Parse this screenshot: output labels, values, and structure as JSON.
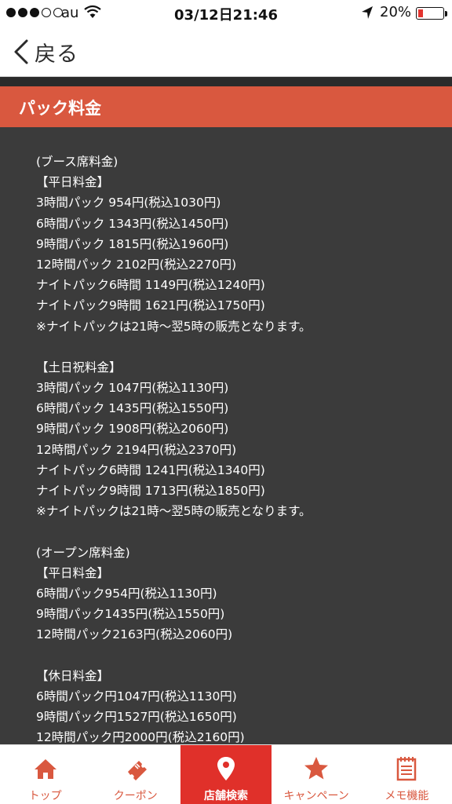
{
  "status_bar": {
    "carrier": "au",
    "time": "03/12日21:46",
    "battery": "20%",
    "battery_level": 0.2,
    "signal_dots_filled": 3,
    "signal_dots_total": 5
  },
  "nav": {
    "back_label": "戻る"
  },
  "section": {
    "title": "パック料金"
  },
  "content_lines": [
    "(ブース席料金)",
    "【平日料金】",
    "3時間パック 954円(税込1030円)",
    "6時間パック 1343円(税込1450円)",
    "9時間パック 1815円(税込1960円)",
    "12時間パック 2102円(税込2270円)",
    "ナイトパック6時間 1149円(税込1240円)",
    "ナイトパック9時間 1621円(税込1750円)",
    "※ナイトパックは21時～翌5時の販売となります。",
    "",
    "【土日祝料金】",
    "3時間パック 1047円(税込1130円)",
    "6時間パック 1435円(税込1550円)",
    "9時間パック 1908円(税込2060円)",
    "12時間パック 2194円(税込2370円)",
    "ナイトパック6時間 1241円(税込1340円)",
    "ナイトパック9時間 1713円(税込1850円)",
    "※ナイトパックは21時～翌5時の販売となります。",
    "",
    "(オープン席料金)",
    "【平日料金】",
    "6時間パック954円(税込1130円)",
    "9時間パック1435円(税込1550円)",
    "12時間パック2163円(税込2060円)",
    "",
    "【休日料金】",
    "6時間パック円1047円(税込1130円)",
    "9時間パック円1527円(税込1650円)",
    "12時間パック円2000円(税込2160円)"
  ],
  "tabs": [
    {
      "label": "トップ",
      "icon": "home-icon",
      "active": false
    },
    {
      "label": "クーポン",
      "icon": "ticket-icon",
      "active": false
    },
    {
      "label": "店舗検索",
      "icon": "map-pin-icon",
      "active": true
    },
    {
      "label": "キャンペーン",
      "icon": "star-icon",
      "active": false
    },
    {
      "label": "メモ機能",
      "icon": "notepad-icon",
      "active": false
    }
  ],
  "colors": {
    "accent": "#d9583f",
    "active_tab": "#e0302a",
    "content_bg": "#3b3b3b"
  }
}
